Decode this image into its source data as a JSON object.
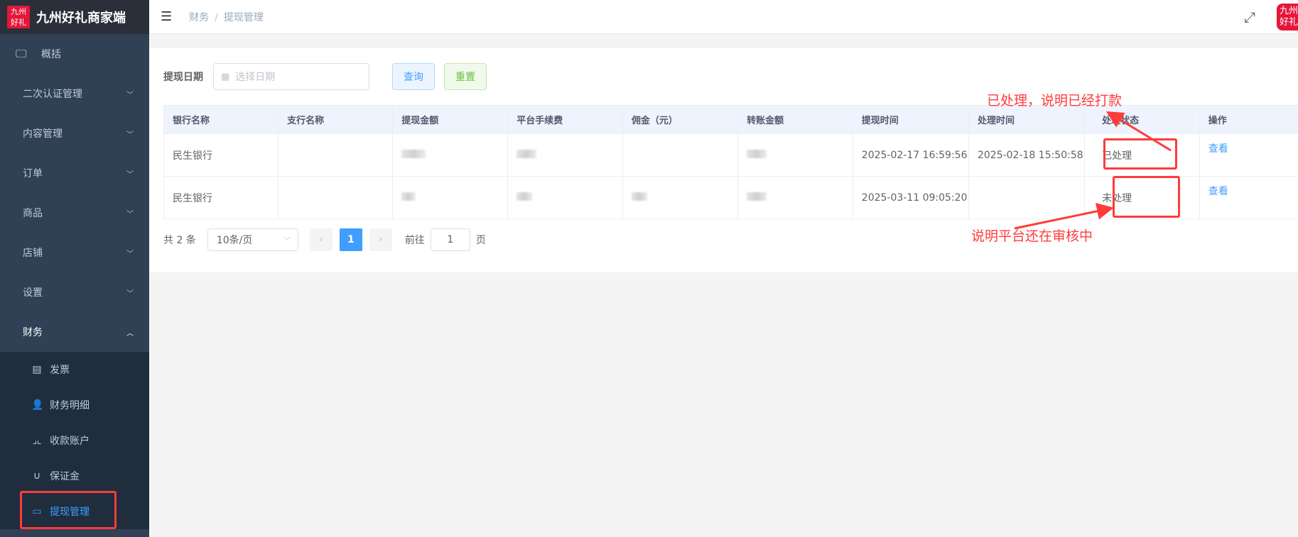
{
  "app": {
    "logo_text": "九州好礼",
    "title": "九州好礼商家端"
  },
  "sidebar": {
    "items": [
      {
        "label": "概括",
        "icon": "monitor-icon"
      },
      {
        "label": "二次认证管理"
      },
      {
        "label": "内容管理"
      },
      {
        "label": "订单"
      },
      {
        "label": "商品"
      },
      {
        "label": "店铺"
      },
      {
        "label": "设置"
      },
      {
        "label": "财务",
        "open": true
      }
    ],
    "sub_items": [
      {
        "label": "发票",
        "icon": "document-icon"
      },
      {
        "label": "财务明细",
        "icon": "user-card-icon"
      },
      {
        "label": "收款账户",
        "icon": "shrink-icon"
      },
      {
        "label": "保证金",
        "icon": "magnet-icon"
      },
      {
        "label": "提现管理",
        "icon": "wallet-icon",
        "active": true
      }
    ]
  },
  "header": {
    "breadcrumb": [
      "财务",
      "提现管理"
    ],
    "avatar_text": "九州好礼"
  },
  "filter": {
    "label": "提现日期",
    "placeholder": "选择日期",
    "query": "查询",
    "reset": "重置"
  },
  "table": {
    "columns": [
      "银行名称",
      "支行名称",
      "提现金额",
      "平台手续费",
      "佣金（元）",
      "转账金额",
      "提现时间",
      "处理时间",
      "处理状态",
      "操作"
    ],
    "rows": [
      {
        "bank": "民生银行",
        "branch": "",
        "submit_time": "2025-02-17 16:59:56",
        "process_time": "2025-02-18 15:50:58",
        "status": "已处理",
        "action": "查看"
      },
      {
        "bank": "民生银行",
        "branch": "",
        "submit_time": "2025-03-11 09:05:20",
        "process_time": "",
        "status": "未处理",
        "action": "查看"
      }
    ]
  },
  "pagination": {
    "total": "共 2 条",
    "page_size": "10条/页",
    "current": "1",
    "goto_label": "前往",
    "goto_value": "1",
    "page_suffix": "页"
  },
  "annotations": {
    "processed": "已处理，说明已经打款",
    "pending": "说明平台还在审核中",
    "color": "#ff3b3b"
  },
  "colors": {
    "sidebar": "#304156",
    "accent": "#409eff",
    "success": "#67c23a"
  }
}
